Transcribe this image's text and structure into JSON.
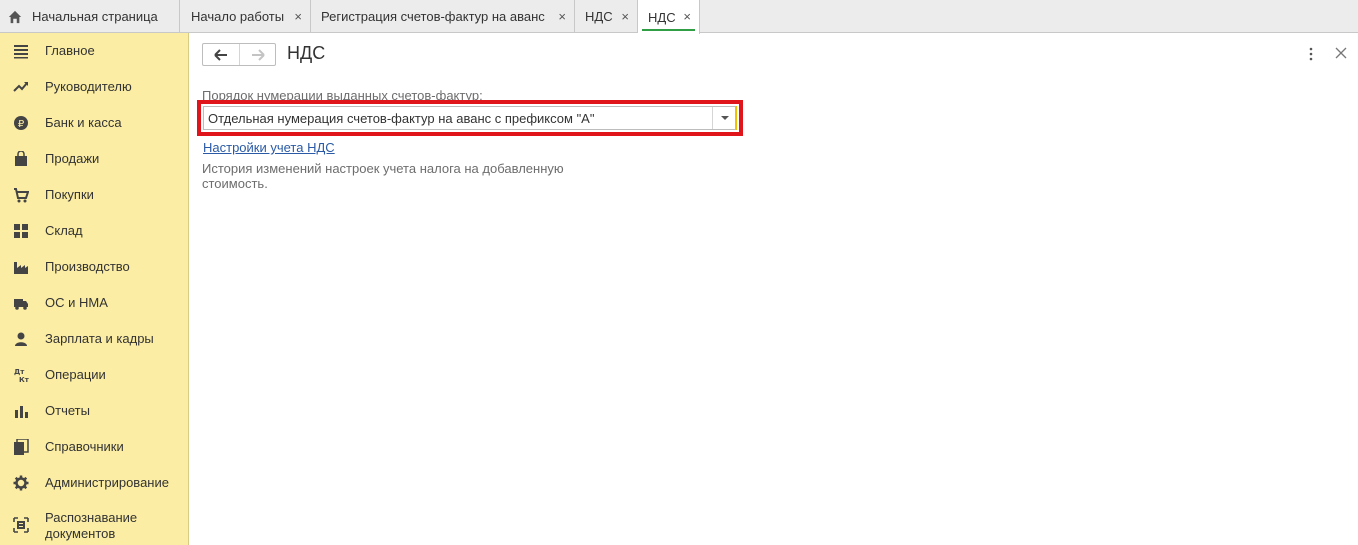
{
  "tabs": {
    "home": "Начальная страница",
    "items": [
      {
        "label": "Начало работы"
      },
      {
        "label": "Регистрация счетов-фактур на аванс"
      },
      {
        "label": "НДС"
      },
      {
        "label": "НДС",
        "active": true
      }
    ],
    "close_glyph": "×"
  },
  "sidebar": {
    "items": [
      {
        "label": "Главное",
        "icon": "menu-icon"
      },
      {
        "label": "Руководителю",
        "icon": "trend-icon"
      },
      {
        "label": "Банк и касса",
        "icon": "ruble-icon"
      },
      {
        "label": "Продажи",
        "icon": "bag-icon"
      },
      {
        "label": "Покупки",
        "icon": "cart-icon"
      },
      {
        "label": "Склад",
        "icon": "warehouse-icon"
      },
      {
        "label": "Производство",
        "icon": "factory-icon"
      },
      {
        "label": "ОС и НМА",
        "icon": "truck-icon"
      },
      {
        "label": "Зарплата и кадры",
        "icon": "person-icon"
      },
      {
        "label": "Операции",
        "icon": "dt-kt-icon"
      },
      {
        "label": "Отчеты",
        "icon": "bar-chart-icon"
      },
      {
        "label": "Справочники",
        "icon": "books-icon"
      },
      {
        "label": "Администрирование",
        "icon": "gear-icon"
      },
      {
        "label_line1": "Распознавание",
        "label_line2": "документов",
        "icon": "scan-icon"
      }
    ]
  },
  "page": {
    "title": "НДС",
    "field_label": "Порядок нумерации выданных счетов-фактур:",
    "field_value": "Отдельная нумерация счетов-фактур на аванс с префиксом \"А\"",
    "link": "Настройки учета НДС",
    "hint": "История изменений настроек учета налога на добавленную стоимость."
  },
  "colors": {
    "sidebar_bg": "#fbeda4",
    "highlight": "#e0141b",
    "link": "#2a5aa5",
    "active_tab_underline": "#2f9e44"
  }
}
